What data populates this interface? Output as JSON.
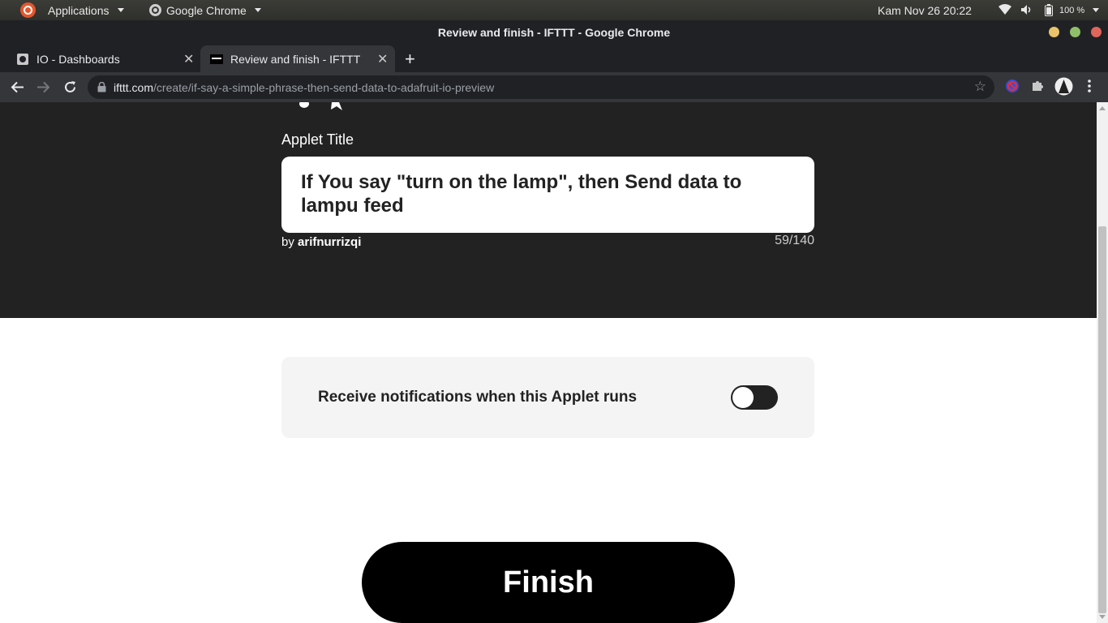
{
  "topbar": {
    "applications_label": "Applications",
    "app_label": "Google Chrome",
    "datetime": "Kam Nov 26  20:22",
    "battery": "100 %"
  },
  "window": {
    "title": "Review and finish - IFTTT - Google Chrome"
  },
  "tabs": [
    {
      "label": "IO - Dashboards"
    },
    {
      "label": "Review and finish - IFTTT"
    }
  ],
  "address": {
    "host": "ifttt.com",
    "path": "/create/if-say-a-simple-phrase-then-send-data-to-adafruit-io-preview"
  },
  "applet": {
    "title_label": "Applet Title",
    "title_value": "If You say \"turn on the lamp\", then Send data to lampu feed",
    "by_prefix": "by",
    "author": "arifnurrizqi",
    "char_count": "59/140"
  },
  "notifications": {
    "label": "Receive notifications when this Applet runs",
    "enabled": false
  },
  "finish_label": "Finish",
  "colors": {
    "hero_bg": "#222222",
    "accent": "#000000"
  }
}
